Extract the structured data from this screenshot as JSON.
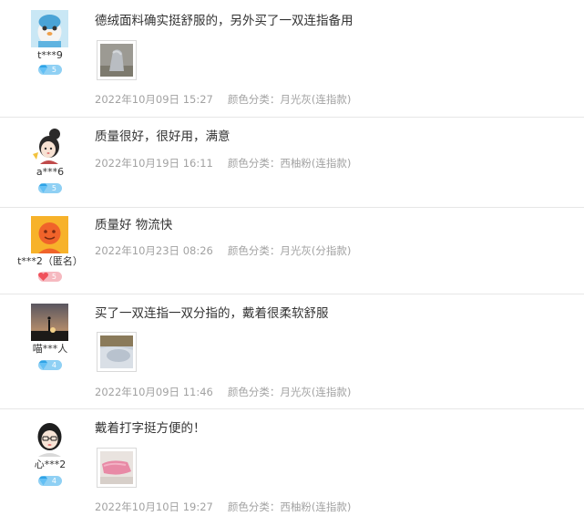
{
  "reviews": [
    {
      "username": "t***9",
      "level": "5",
      "badge_type": "diamond",
      "avatar_icon": "cartoon-penguin-avatar",
      "text": "德绒面料确实挺舒服的，另外买了一双连指备用",
      "has_photo": true,
      "photo_icon": "gray-glove-photo",
      "date": "2022年10月09日 15:27",
      "spec": "颜色分类：月光灰(连指款)"
    },
    {
      "username": "a***6",
      "level": "5",
      "badge_type": "diamond",
      "avatar_icon": "cartoon-girl-avatar",
      "text": "质量很好，很好用，满意",
      "has_photo": false,
      "date": "2022年10月19日 16:11",
      "spec": "颜色分类：西柚粉(连指款)"
    },
    {
      "username": "t***2（匿名）",
      "level": "5",
      "badge_type": "heart",
      "avatar_icon": "orange-default-avatar",
      "text": "质量好 物流快",
      "has_photo": false,
      "date": "2022年10月23日 08:26",
      "spec": "颜色分类：月光灰(分指款)"
    },
    {
      "username": "喵***人",
      "level": "4",
      "badge_type": "diamond",
      "avatar_icon": "sunset-silhouette-avatar",
      "text": "买了一双连指一双分指的，戴着很柔软舒服",
      "has_photo": true,
      "photo_icon": "glove-on-bed-photo",
      "date": "2022年10月09日 11:46",
      "spec": "颜色分类：月光灰(连指款)"
    },
    {
      "username": "心***2",
      "level": "4",
      "badge_type": "diamond",
      "avatar_icon": "cartoon-glasses-girl-avatar",
      "text": "戴着打字挺方便的！",
      "has_photo": true,
      "photo_icon": "pink-glove-photo",
      "date": "2022年10月10日 19:27",
      "spec": "颜色分类：西柚粉(连指款)"
    }
  ],
  "colors": {
    "diamond_badge": "#8fd0f4",
    "heart_badge": "#f6b9c0",
    "meta_text": "#a2a2a2",
    "divider": "#e6e6e6"
  }
}
